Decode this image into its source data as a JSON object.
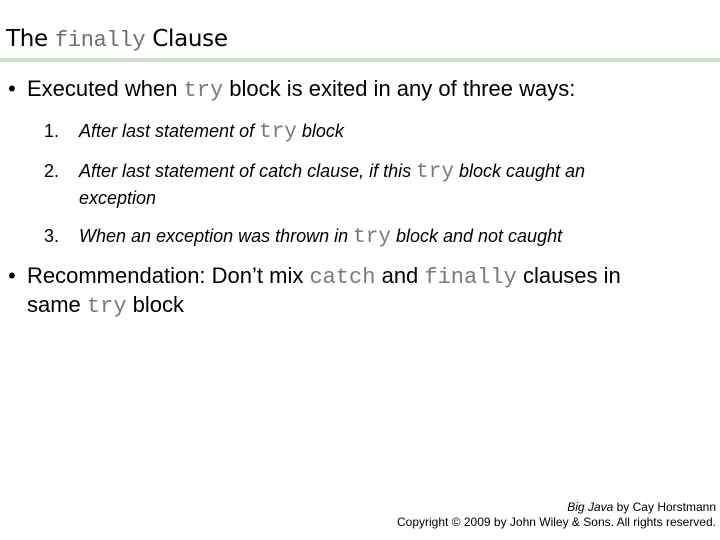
{
  "slide": {
    "title": {
      "pre": "The",
      "code": "finally",
      "post": "Clause"
    },
    "bullets": [
      {
        "parts": [
          {
            "text": "Executed when ",
            "code": false
          },
          {
            "text": "try",
            "code": true
          },
          {
            "text": " block is exited in any of three ways:",
            "code": false
          }
        ]
      },
      {
        "line1": [
          {
            "text": "Recommendation: Don’t mix ",
            "code": false
          },
          {
            "text": "catch",
            "code": true
          },
          {
            "text": " and ",
            "code": false
          },
          {
            "text": "finally",
            "code": true
          },
          {
            "text": " clauses in",
            "code": false
          }
        ],
        "line2": [
          {
            "text": "same ",
            "code": false
          },
          {
            "text": "try",
            "code": true
          },
          {
            "text": " block",
            "code": false
          }
        ]
      }
    ],
    "bullet_glyph": "•",
    "numbered": [
      {
        "num": "1.",
        "line1": [
          {
            "text": "After last statement of ",
            "code": false
          },
          {
            "text": "try",
            "code": true
          },
          {
            "text": " block",
            "code": false
          }
        ]
      },
      {
        "num": "2.",
        "line1": [
          {
            "text": "After last statement of catch clause, if this ",
            "code": false
          },
          {
            "text": "try",
            "code": true
          },
          {
            "text": " block caught an",
            "code": false
          }
        ],
        "line2": "exception"
      },
      {
        "num": "3.",
        "line1": [
          {
            "text": "When an exception was thrown in ",
            "code": false
          },
          {
            "text": "try",
            "code": true
          },
          {
            "text": " block and not caught",
            "code": false
          }
        ]
      }
    ]
  },
  "footer": {
    "book_title": "Big Java",
    "book_author": " by Cay Horstmann",
    "copyright": "Copyright © 2009 by John Wiley & Sons.  All rights reserved."
  },
  "colors": {
    "rule": "#c8e3bd",
    "code": "#7a7a7a"
  }
}
